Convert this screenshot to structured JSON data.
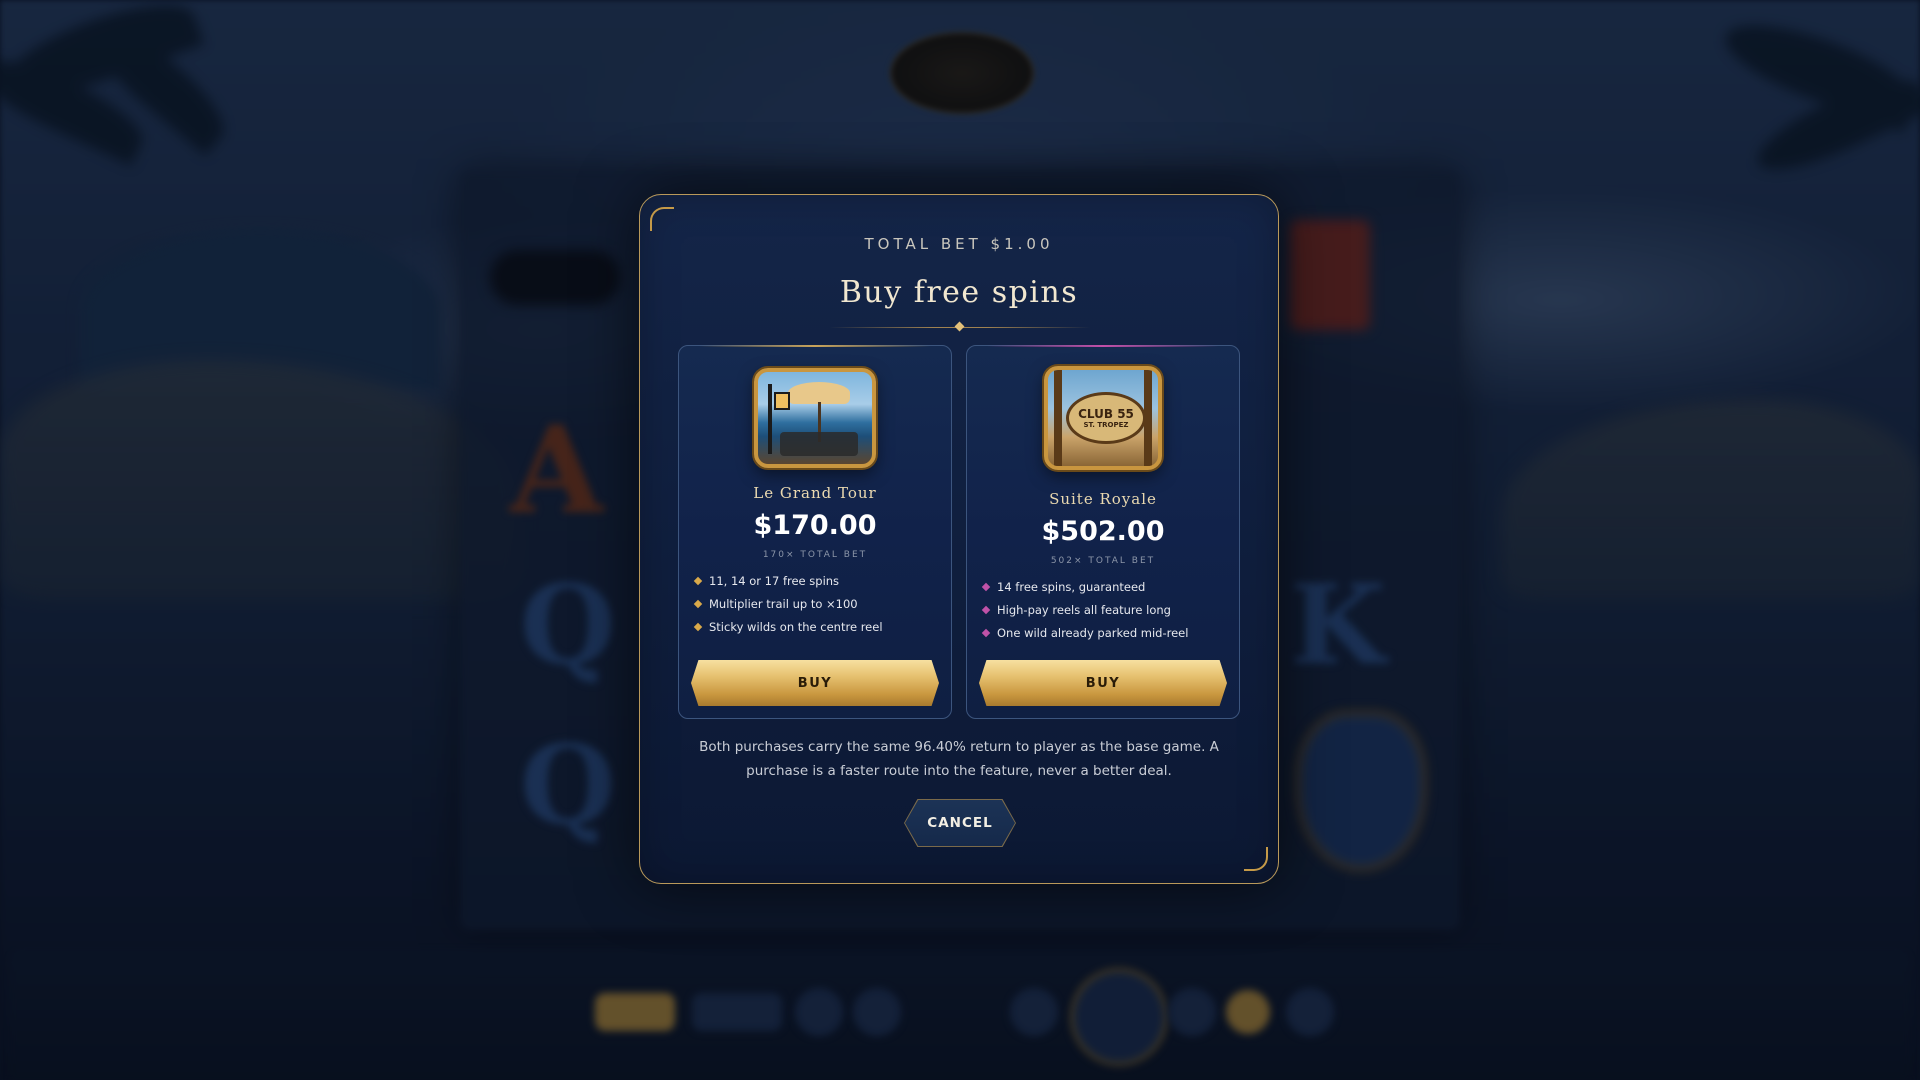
{
  "modal": {
    "total_bet_label": "TOTAL BET $1.00",
    "title": "Buy free spins",
    "disclaimer": "Both purchases carry the same 96.40% return to player as the base game. A purchase is a faster route into the feature, never a better deal.",
    "cancel_label": "CANCEL"
  },
  "options": [
    {
      "name": "Le Grand Tour",
      "price": "$170.00",
      "multiplier": "170× TOTAL BET",
      "features": [
        "11, 14 or 17 free spins",
        "Multiplier trail up to ×100",
        "Sticky wilds on the centre reel"
      ],
      "buy_label": "BUY",
      "accent_color": "#d9a94a",
      "art_icon": "cafe-terrace-icon"
    },
    {
      "name": "Suite Royale",
      "price": "$502.00",
      "multiplier": "502× TOTAL BET",
      "features": [
        "14 free spins, guaranteed",
        "High-pay reels all feature long",
        "One wild already parked mid-reel"
      ],
      "buy_label": "BUY",
      "accent_color": "#c052a8",
      "art_icon": "club-sign-icon",
      "art_sign_line1": "CLUB 55",
      "art_sign_line2": "ST. TROPEZ"
    }
  ],
  "colors": {
    "gold": "#c9963f",
    "panel": "#0f1e3d",
    "border": "#b9995a"
  }
}
